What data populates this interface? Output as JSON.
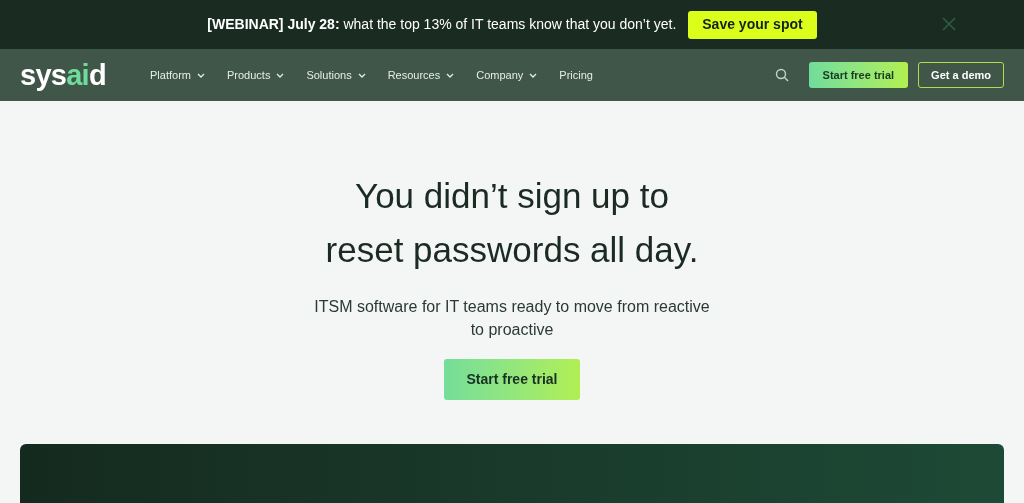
{
  "banner": {
    "text": "**[WEBINAR] July 28:** what the top 13% of IT teams know that you don’t yet.",
    "button": "Save your spot"
  },
  "header": {
    "logo": [
      {
        "text": "sys",
        "accent": false
      },
      {
        "text": "ai",
        "accent": true
      },
      {
        "text": "d",
        "accent": false
      }
    ],
    "nav": [
      {
        "label": "Platform",
        "dropdown": true
      },
      {
        "label": "Products",
        "dropdown": true
      },
      {
        "label": "Solutions",
        "dropdown": true
      },
      {
        "label": "Resources",
        "dropdown": true
      },
      {
        "label": "Company",
        "dropdown": true
      },
      {
        "label": "Pricing",
        "dropdown": false
      }
    ],
    "trial_button": "Start free trial",
    "demo_button": "Get a demo"
  },
  "hero": {
    "headline": [
      "You didn’t sign up to",
      "reset passwords all day."
    ],
    "subtitle": "ITSM software for IT teams ready to move from reactive to proactive",
    "button": "Start free trial"
  }
}
